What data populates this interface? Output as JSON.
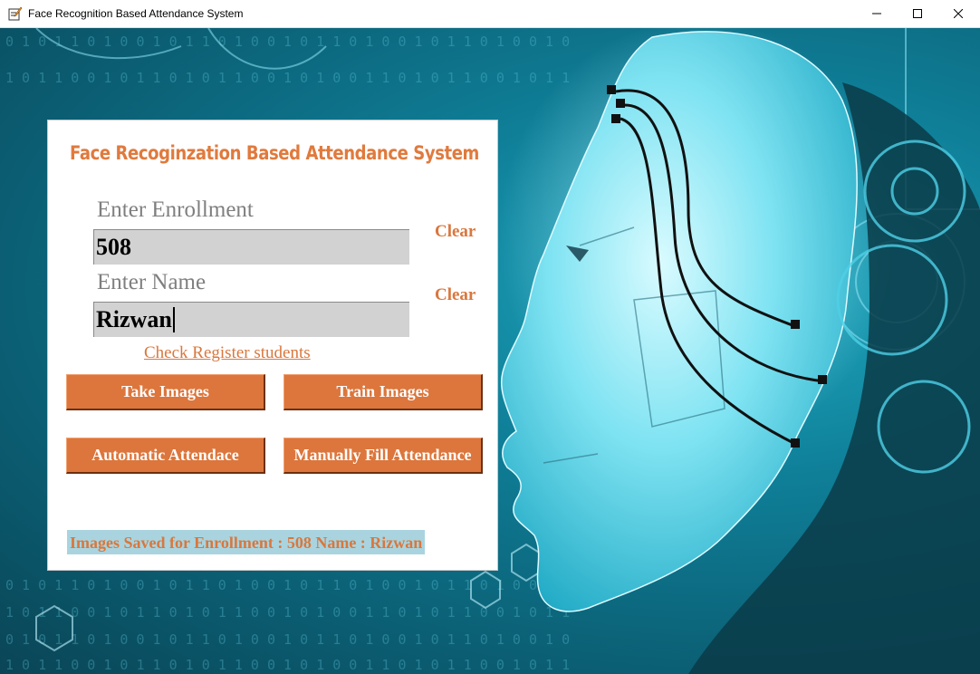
{
  "window": {
    "title": "Face Recognition Based Attendance System",
    "controls": [
      "minimize",
      "maximize",
      "close"
    ]
  },
  "panel": {
    "heading": "Face Recoginzation Based Attendance System",
    "enrollment": {
      "label": "Enter Enrollment",
      "value": "508",
      "clear_label": "Clear"
    },
    "name": {
      "label": "Enter Name",
      "value": "Rizwan",
      "clear_label": "Clear"
    },
    "register_link": "Check Register students",
    "buttons": {
      "take_images": "Take Images",
      "train_images": "Train Images",
      "automatic_attendance": "Automatic Attendace",
      "manual_attendance": "Manually Fill Attendance"
    },
    "status_message": "Images Saved for Enrollment : 508 Name : Rizwan"
  },
  "colors": {
    "accent": "#dc763c",
    "label_gray": "#7f7f7f",
    "input_bg": "#d2d2d2",
    "status_bg": "#a9d4df",
    "scene_teal": "#1fa8c0"
  }
}
